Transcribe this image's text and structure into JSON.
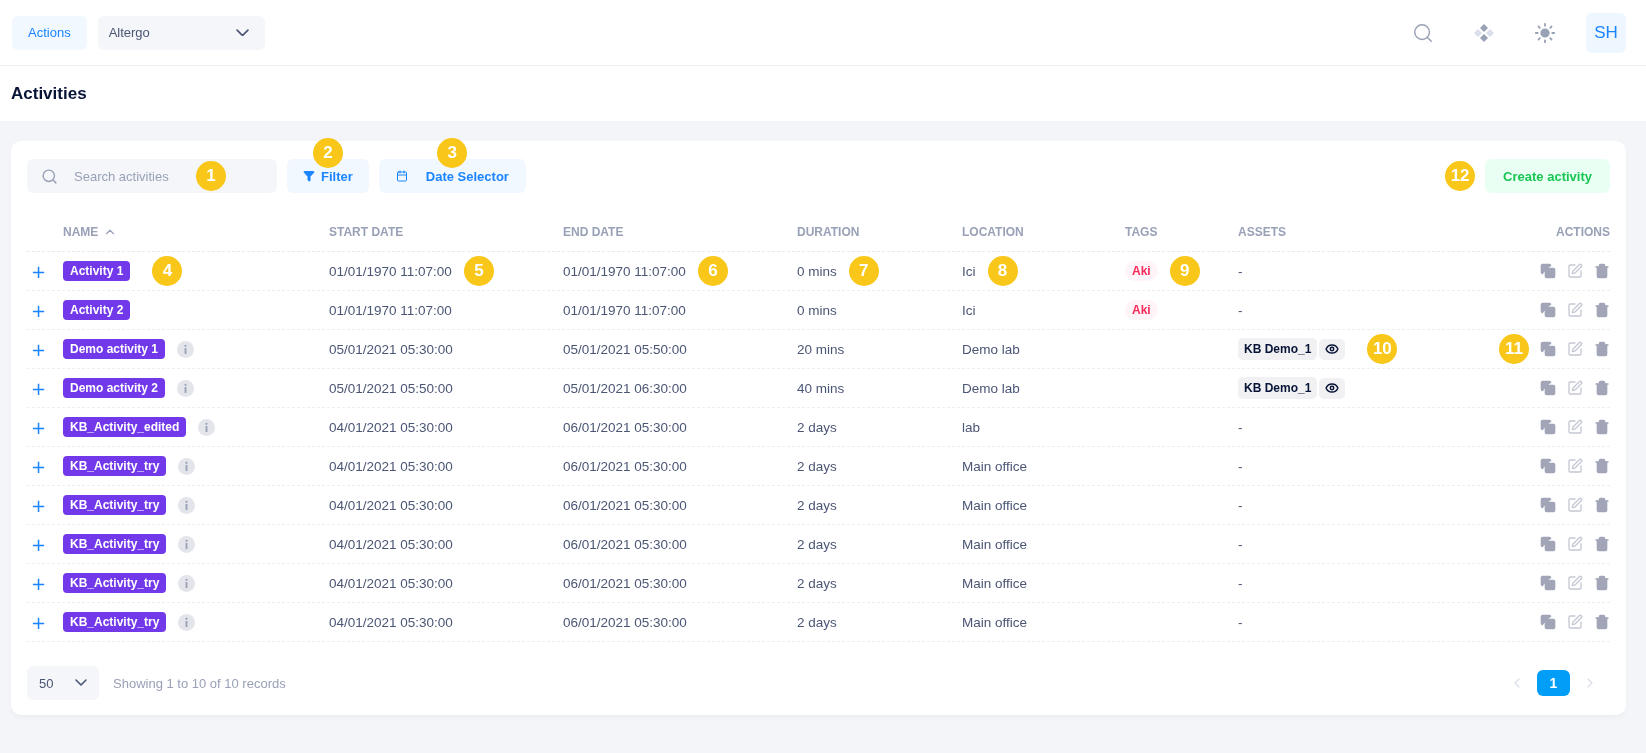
{
  "topbar": {
    "actions_button": "Actions",
    "org_select": "Altergo",
    "avatar": "SH"
  },
  "page_title": "Activities",
  "toolbar": {
    "search": {
      "placeholder": "Search activities",
      "marker": "1"
    },
    "filter": {
      "label": "Filter",
      "marker": "2"
    },
    "date_selector": {
      "label": "Date Selector",
      "marker": "3"
    },
    "create": {
      "label": "Create activity",
      "marker": "12"
    }
  },
  "table": {
    "columns": [
      {
        "kind": "name",
        "label": "NAME",
        "sorted": true
      },
      {
        "kind": "start",
        "label": "START DATE",
        "sorted": false
      },
      {
        "kind": "end",
        "label": "END DATE",
        "sorted": false
      },
      {
        "kind": "duration",
        "label": "DURATION",
        "sorted": false
      },
      {
        "kind": "location",
        "label": "LOCATION",
        "sorted": false
      },
      {
        "kind": "tags",
        "label": "TAGS",
        "sorted": false
      },
      {
        "kind": "assets",
        "label": "ASSETS",
        "sorted": false
      },
      {
        "kind": "actions",
        "label": "ACTIONS",
        "sorted": false
      }
    ],
    "rows": [
      {
        "expand": "+",
        "name": "Activity 1",
        "info": false,
        "start": "01/01/1970 11:07:00",
        "end": "01/01/1970 11:07:00",
        "duration": "0 mins",
        "location": "Ici",
        "tags": [
          "Aki"
        ],
        "assets_empty": "-",
        "markers": {
          "name": "4",
          "start": "5",
          "end": "6",
          "duration": "7",
          "location": "8",
          "tags": "9"
        }
      },
      {
        "expand": "+",
        "name": "Activity 2",
        "info": false,
        "start": "01/01/1970 11:07:00",
        "end": "01/01/1970 11:07:00",
        "duration": "0 mins",
        "location": "Ici",
        "tags": [
          "Aki"
        ],
        "assets_empty": "-"
      },
      {
        "expand": "+",
        "name": "Demo activity 1",
        "info": true,
        "start": "05/01/2021 05:30:00",
        "end": "05/01/2021 05:50:00",
        "duration": "20 mins",
        "location": "Demo lab",
        "assets": [
          "KB Demo_1"
        ],
        "markers": {
          "assets": "10",
          "actions": "11"
        }
      },
      {
        "expand": "+",
        "name": "Demo activity 2",
        "info": true,
        "start": "05/01/2021 05:50:00",
        "end": "05/01/2021 06:30:00",
        "duration": "40 mins",
        "location": "Demo lab",
        "assets": [
          "KB Demo_1"
        ]
      },
      {
        "expand": "+",
        "name": "KB_Activity_edited",
        "info": true,
        "start": "04/01/2021 05:30:00",
        "end": "06/01/2021 05:30:00",
        "duration": "2 days",
        "location": "lab",
        "assets_empty": "-"
      },
      {
        "expand": "+",
        "name": "KB_Activity_try",
        "info": true,
        "start": "04/01/2021 05:30:00",
        "end": "06/01/2021 05:30:00",
        "duration": "2 days",
        "location": "Main office",
        "assets_empty": "-"
      },
      {
        "expand": "+",
        "name": "KB_Activity_try",
        "info": true,
        "start": "04/01/2021 05:30:00",
        "end": "06/01/2021 05:30:00",
        "duration": "2 days",
        "location": "Main office",
        "assets_empty": "-"
      },
      {
        "expand": "+",
        "name": "KB_Activity_try",
        "info": true,
        "start": "04/01/2021 05:30:00",
        "end": "06/01/2021 05:30:00",
        "duration": "2 days",
        "location": "Main office",
        "assets_empty": "-"
      },
      {
        "expand": "+",
        "name": "KB_Activity_try",
        "info": true,
        "start": "04/01/2021 05:30:00",
        "end": "06/01/2021 05:30:00",
        "duration": "2 days",
        "location": "Main office",
        "assets_empty": "-"
      },
      {
        "expand": "+",
        "name": "KB_Activity_try",
        "info": true,
        "start": "04/01/2021 05:30:00",
        "end": "06/01/2021 05:30:00",
        "duration": "2 days",
        "location": "Main office",
        "assets_empty": "-"
      }
    ]
  },
  "footer": {
    "page_size": "50",
    "summary": "Showing 1 to 10 of 10 records",
    "pages": [
      {
        "label": "1",
        "selected": true
      }
    ],
    "prev_disabled": true,
    "next_disabled": true
  }
}
